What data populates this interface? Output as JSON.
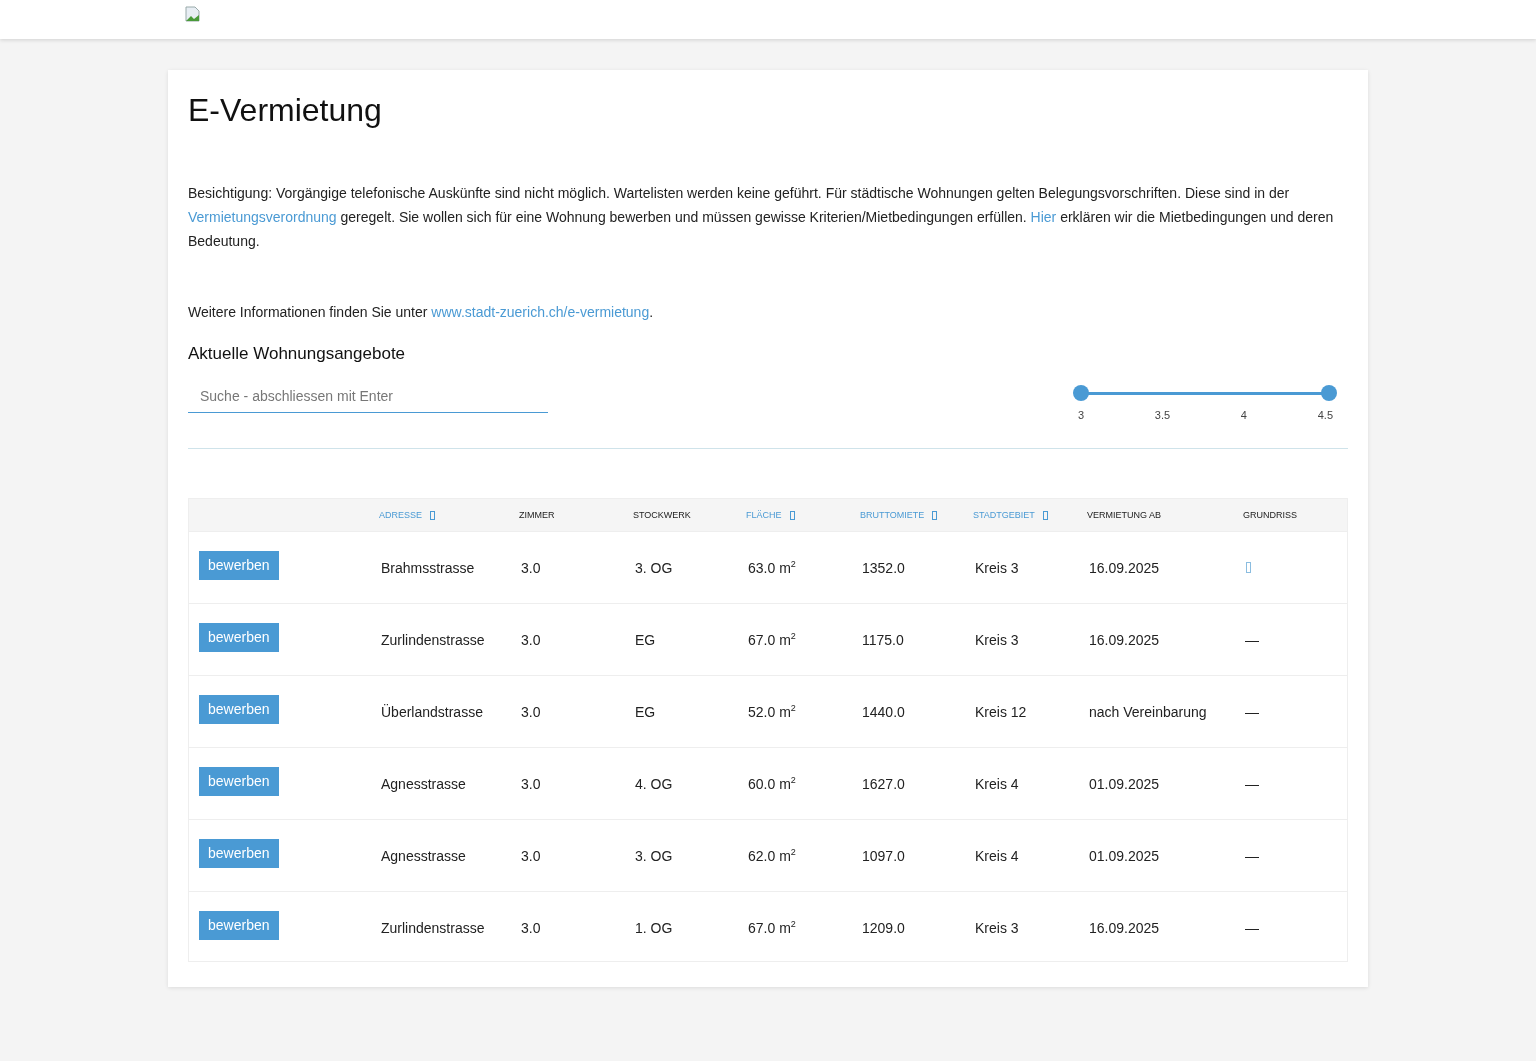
{
  "title": "E-Vermietung",
  "intro": [
    {
      "kind": "text",
      "text": "Besichtigung: Vorgängige telefonische Auskünfte sind nicht möglich. Wartelisten werden keine geführt. Für städtische Wohnungen gelten Belegungsvorschriften. Diese sind in der "
    },
    {
      "kind": "link",
      "text": "Vermietungsverordnung"
    },
    {
      "kind": "text",
      "text": " geregelt. Sie wollen sich für eine Wohnung bewerben und müssen gewisse Kriterien/Mietbedingungen erfüllen. "
    },
    {
      "kind": "link",
      "text": "Hier"
    },
    {
      "kind": "text",
      "text": " erklären wir die Mietbedingungen und deren Bedeutung."
    }
  ],
  "more_info": [
    {
      "kind": "text",
      "text": "Weitere Informationen finden Sie unter "
    },
    {
      "kind": "link",
      "text": "www.stadt-zuerich.ch/e-vermietung"
    },
    {
      "kind": "text",
      "text": "."
    }
  ],
  "subtitle": "Aktuelle Wohnungsangebote",
  "search": {
    "placeholder": "Suche - abschliessen mit Enter"
  },
  "slider": {
    "thumbs": [
      {
        "level": 0
      },
      {
        "level": 1
      }
    ],
    "ticks": [
      "3",
      "3.5",
      "4",
      "4.5"
    ]
  },
  "table": {
    "columns": [
      {
        "label": "ADRESSE",
        "sortable": true
      },
      {
        "label": "ZIMMER",
        "sortable": false
      },
      {
        "label": "STOCKWERK",
        "sortable": false
      },
      {
        "label": "FLÄCHE",
        "sortable": true
      },
      {
        "label": "BRUTTOMIETE",
        "sortable": true
      },
      {
        "label": "STADTGEBIET",
        "sortable": true
      },
      {
        "label": "VERMIETUNG AB",
        "sortable": false
      },
      {
        "label": "GRUNDRISS",
        "sortable": false
      }
    ],
    "rows": [
      {
        "button": "bewerben",
        "address": "Brahmsstrasse",
        "rooms": "3.0",
        "floor": "3. OG",
        "area": "63.0 m$^{2}$",
        "rent": "1352.0",
        "district": "Kreis 3",
        "available": "16.09.2025",
        "plan": {
          "kind": "link"
        }
      },
      {
        "button": "bewerben",
        "address": "Zurlindenstrasse",
        "rooms": "3.0",
        "floor": "EG",
        "area": "67.0 m$^{2}$",
        "rent": "1175.0",
        "district": "Kreis 3",
        "available": "16.09.2025",
        "plan": {
          "kind": "text",
          "text": "—"
        }
      },
      {
        "button": "bewerben",
        "address": "Überlandstrasse",
        "rooms": "3.0",
        "floor": "EG",
        "area": "52.0 m$^{2}$",
        "rent": "1440.0",
        "district": "Kreis 12",
        "available": "nach Vereinbarung",
        "plan": {
          "kind": "text",
          "text": "—"
        }
      },
      {
        "button": "bewerben",
        "address": "Agnesstrasse",
        "rooms": "3.0",
        "floor": "4. OG",
        "area": "60.0 m$^{2}$",
        "rent": "1627.0",
        "district": "Kreis 4",
        "available": "01.09.2025",
        "plan": {
          "kind": "text",
          "text": "—"
        }
      },
      {
        "button": "bewerben",
        "address": "Agnesstrasse",
        "rooms": "3.0",
        "floor": "3. OG",
        "area": "62.0 m$^{2}$",
        "rent": "1097.0",
        "district": "Kreis 4",
        "available": "01.09.2025",
        "plan": {
          "kind": "text",
          "text": "—"
        }
      },
      {
        "button": "bewerben",
        "address": "Zurlindenstrasse",
        "rooms": "3.0",
        "floor": "1. OG",
        "area": "67.0 m$^{2}$",
        "rent": "1209.0",
        "district": "Kreis 3",
        "available": "16.09.2025",
        "plan": {
          "kind": "text",
          "text": "—"
        }
      }
    ]
  }
}
